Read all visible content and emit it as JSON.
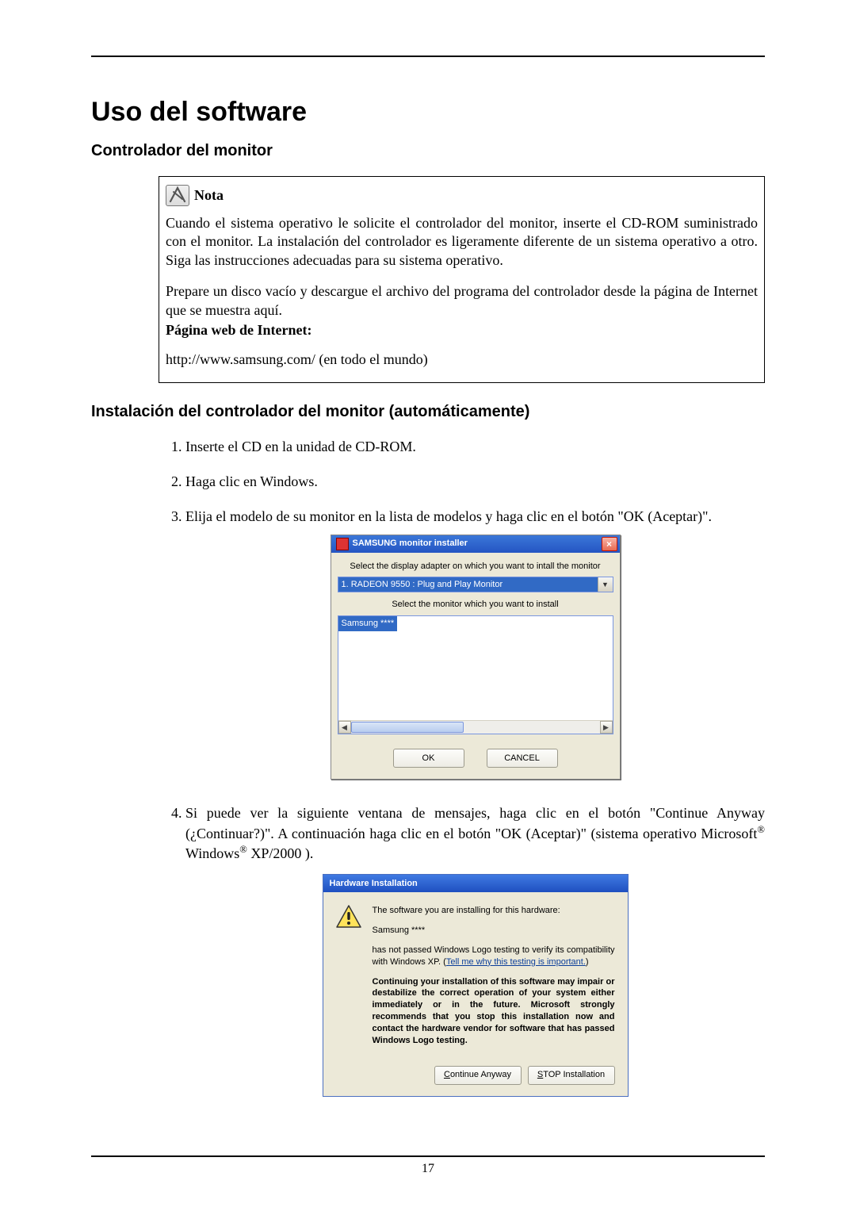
{
  "page": {
    "title": "Uso del software",
    "number": "17"
  },
  "section1": {
    "heading": "Controlador del monitor",
    "note_label": "Nota",
    "note_p1": "Cuando el sistema operativo le solicite el controlador del monitor, inserte el CD-ROM suministrado con el monitor. La instalación del controlador es ligeramente diferente de un sistema operativo a otro. Siga las instrucciones adecuadas para su sistema operativo.",
    "note_p2": "Prepare un disco vacío y descargue el archivo del programa del controlador desde la página de Internet que se muestra aquí.",
    "note_label2": "Página web de Internet:",
    "note_url": "http://www.samsung.com/ (en todo el mundo)"
  },
  "section2": {
    "heading": "Instalación del controlador del monitor (automáticamente)",
    "steps": {
      "s1": "Inserte el CD en la unidad de CD-ROM.",
      "s2": "Haga clic en Windows.",
      "s3": "Elija el modelo de su monitor en la lista de modelos y haga clic en el botón \"OK (Aceptar)\".",
      "s4a": "Si puede ver la siguiente ventana de mensajes, haga clic en el botón \"Continue Anyway (¿Continuar?)\". A continuación haga clic en el botón \"OK (Aceptar)\" (sistema operativo Microsoft",
      "s4b": " Windows",
      "s4c": " XP/2000 )."
    }
  },
  "dlg1": {
    "title": "SAMSUNG monitor installer",
    "label1": "Select the display adapter on which you want to intall the monitor",
    "adapter": "1. RADEON 9550 : Plug and Play Monitor",
    "label2": "Select the monitor which you want to install",
    "list_item": "Samsung ****",
    "ok": "OK",
    "cancel": "CANCEL"
  },
  "dlg2": {
    "title": "Hardware Installation",
    "p1": "The software you are installing for this hardware:",
    "p2": "Samsung ****",
    "p3a": "has not passed Windows Logo testing to verify its compatibility with Windows XP. (",
    "p3link": "Tell me why this testing is important.",
    "p3b": ")",
    "p4": "Continuing your installation of this software may impair or destabilize the correct operation of your system either immediately or in the future. Microsoft strongly recommends that you stop this installation now and contact the hardware vendor for software that has passed Windows Logo testing.",
    "btn_continue_u": "C",
    "btn_continue_rest": "ontinue Anyway",
    "btn_stop_u": "S",
    "btn_stop_rest": "TOP Installation"
  }
}
